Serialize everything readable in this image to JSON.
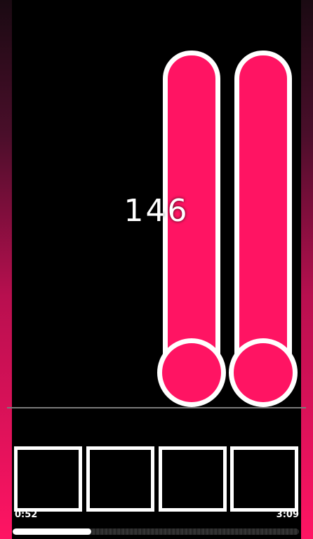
{
  "game": {
    "score": "146",
    "time_elapsed": "0:52",
    "time_total": "3:09",
    "progress_fraction": 0.275,
    "lanes": 4
  },
  "colors": {
    "note_fill": "#ff1463",
    "note_border": "#ffffff",
    "background": "#000000",
    "key_border": "#ffffff"
  }
}
